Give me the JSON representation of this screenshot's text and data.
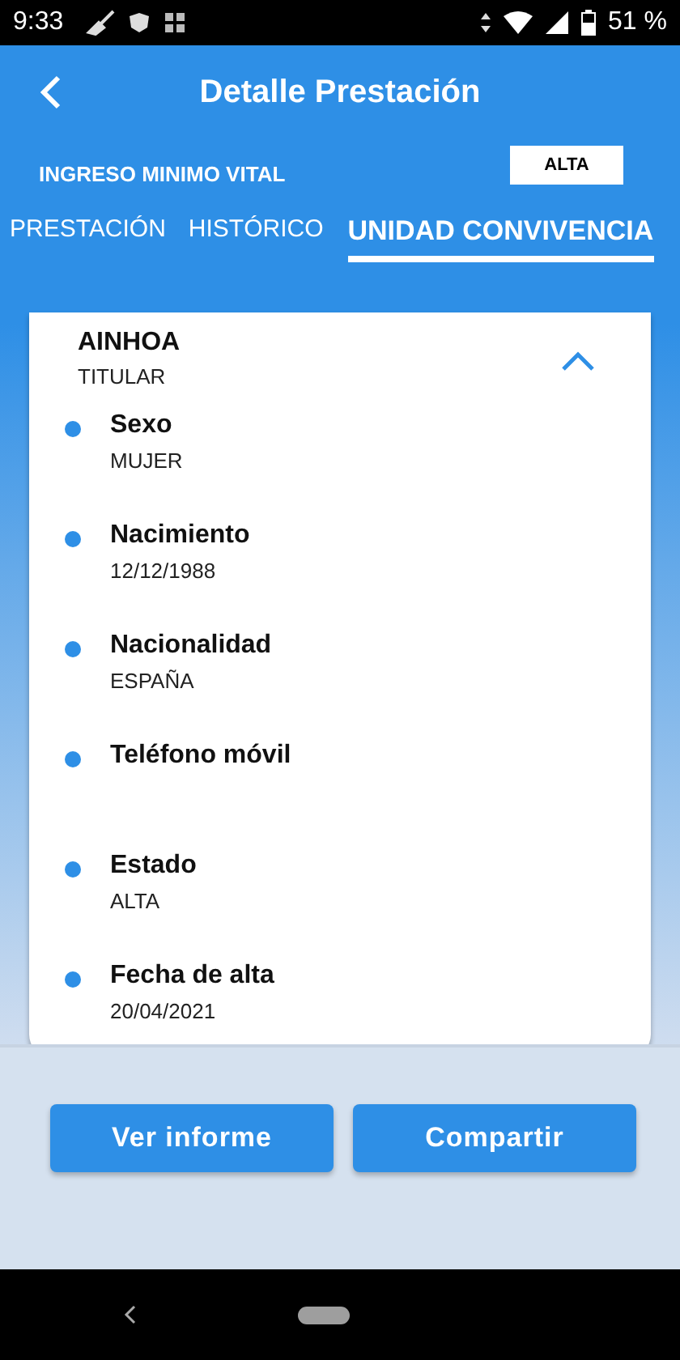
{
  "status_bar": {
    "time": "9:33",
    "battery": "51 %"
  },
  "header": {
    "title": "Detalle Prestación",
    "benefit": "INGRESO MINIMO VITAL",
    "status_badge": "ALTA"
  },
  "tabs": [
    {
      "label": "PRESTACIÓN",
      "selected": false
    },
    {
      "label": "HISTÓRICO",
      "selected": false
    },
    {
      "label": "UNIDAD CONVIVENCIA",
      "selected": true
    }
  ],
  "member": {
    "name": "AINHOA",
    "role": "TITULAR",
    "expanded": true,
    "fields": [
      {
        "label": "Sexo",
        "value": "MUJER"
      },
      {
        "label": "Nacimiento",
        "value": "12/12/1988"
      },
      {
        "label": "Nacionalidad",
        "value": "ESPAÑA"
      },
      {
        "label": "Teléfono móvil"
      },
      {
        "label": "Estado",
        "value": "ALTA"
      },
      {
        "label": "Fecha de alta",
        "value": "20/04/2021"
      }
    ]
  },
  "buttons": [
    "Ver informe",
    "Compartir"
  ]
}
